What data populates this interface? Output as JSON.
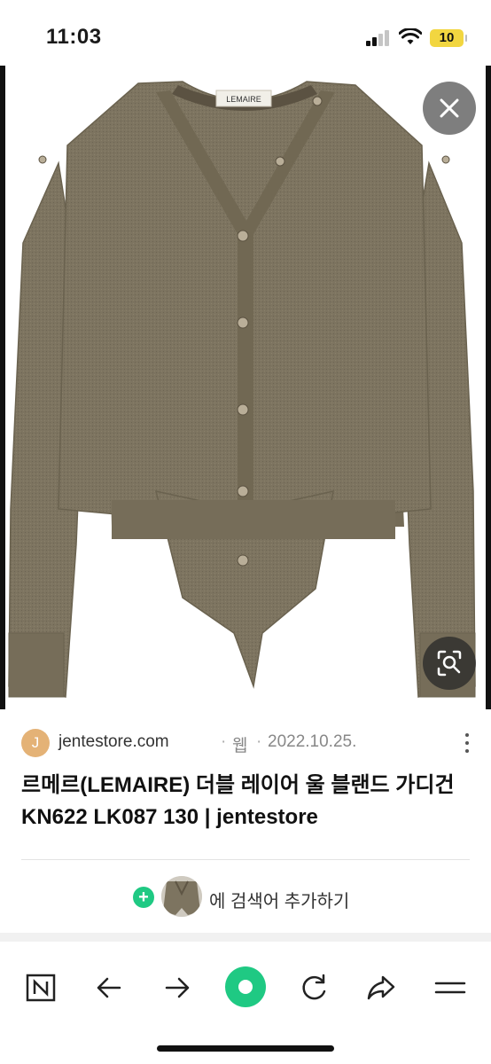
{
  "status_bar": {
    "time": "11:03",
    "battery": "10"
  },
  "product_image": {
    "tag_text": "LEMAIRE"
  },
  "result": {
    "favicon_letter": "J",
    "domain": "jentestore.com",
    "separator": "·",
    "source_type": "웹",
    "date": "2022.10.25.",
    "title": "르메르(LEMAIRE) 더블 레이어 울 블랜드 가디건 KN622 LK087 130 | jentestore"
  },
  "add_search": {
    "plus": "+",
    "label": "에 검색어 추가하기"
  },
  "colors": {
    "accent_green": "#1fc983",
    "favicon": "#e4b276",
    "battery": "#f2d640",
    "sweater": "#7d7460"
  },
  "nav": [
    "n-home-icon",
    "back-arrow-icon",
    "forward-arrow-icon",
    "green-dot-icon",
    "refresh-icon",
    "share-icon",
    "menu-icon"
  ]
}
